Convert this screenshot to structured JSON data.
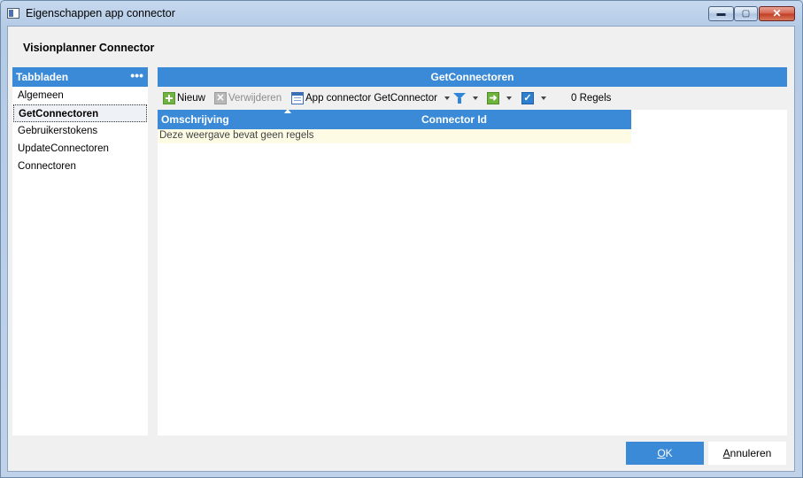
{
  "window": {
    "title": "Eigenschappen app connector",
    "controls": {
      "minimize": "▬",
      "maximize": "▢",
      "close": "✕"
    }
  },
  "header": {
    "label": "Visionplanner Connector"
  },
  "tabs": {
    "title": "Tabbladen",
    "more": "•••",
    "items": [
      {
        "label": "Algemeen",
        "selected": false
      },
      {
        "label": "GetConnectoren",
        "selected": true
      },
      {
        "label": "Gebruikerstokens",
        "selected": false
      },
      {
        "label": "UpdateConnectoren",
        "selected": false
      },
      {
        "label": "Connectoren",
        "selected": false
      }
    ]
  },
  "content": {
    "title": "GetConnectoren",
    "toolbar": {
      "new_label": "Nieuw",
      "delete_label": "Verwijderen",
      "view_label": "App connector GetConnector",
      "record_count": "0 Regels",
      "icons": [
        "plus-icon",
        "delete-icon",
        "grid-view-icon",
        "filter-icon",
        "export-arrow-icon",
        "checkmark-icon"
      ]
    },
    "grid": {
      "columns": [
        "Omschrijving",
        "Connector Id"
      ],
      "empty_message": "Deze weergave bevat geen regels"
    }
  },
  "footer": {
    "ok_underlined": "O",
    "ok_rest": "K",
    "cancel_underlined": "A",
    "cancel_rest": "nnuleren"
  },
  "colors": {
    "accent": "#3b8ad8",
    "empty_row": "#fdfbe4"
  }
}
